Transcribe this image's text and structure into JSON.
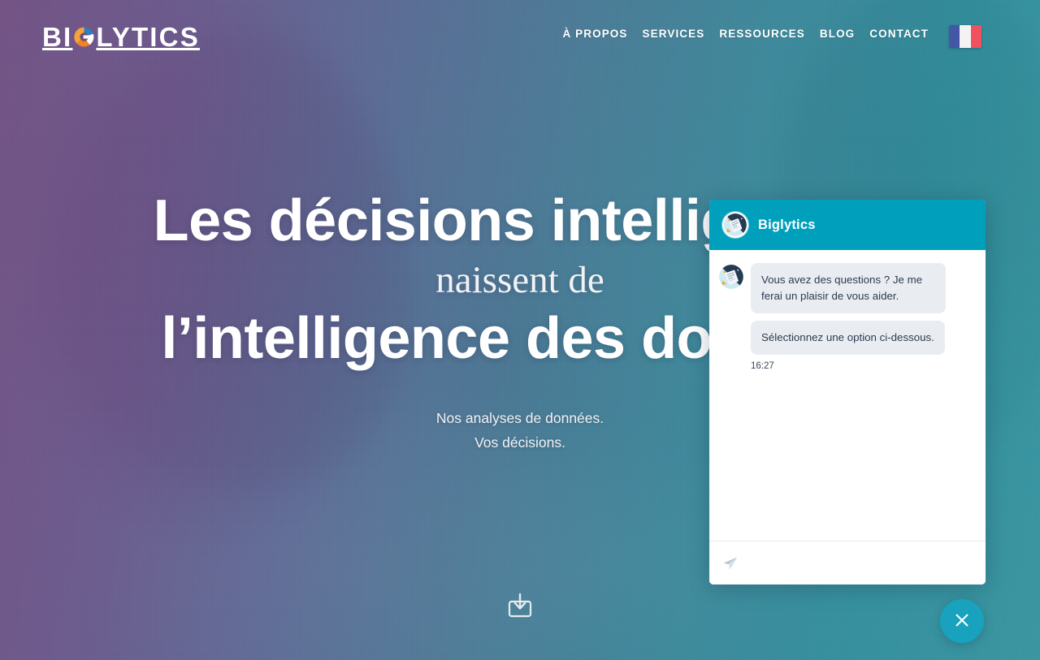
{
  "brand": {
    "logo_text_before": "BI",
    "logo_text_g": "G",
    "logo_text_after": "LYTICS",
    "accent_teal": "#00a0bd",
    "accent_orange": "#f58220",
    "accent_blue": "#2f7fc1"
  },
  "nav": {
    "items": [
      {
        "label": "À PROPOS",
        "name": "nav-a-propos"
      },
      {
        "label": "SERVICES",
        "name": "nav-services"
      },
      {
        "label": "RESSOURCES",
        "name": "nav-ressources"
      },
      {
        "label": "BLOG",
        "name": "nav-blog"
      },
      {
        "label": "CONTACT",
        "name": "nav-contact"
      }
    ],
    "language_flag": "france-flag"
  },
  "hero": {
    "line1": "Les décisions intelligentes",
    "line2": "naissent de",
    "line3": "l’intelligence des données",
    "sub_line1": "Nos analyses de données.",
    "sub_line2": "Vos décisions.",
    "scroll_icon": "download-arrow-icon"
  },
  "chat": {
    "title": "Biglytics",
    "avatar_icon": "biglytics-bot-avatar",
    "messages": [
      {
        "text": "Vous avez des questions ? Je me ferai un plaisir de vous aider.",
        "sender": "bot"
      },
      {
        "text": "Sélectionnez une option ci-dessous.",
        "sender": "bot"
      }
    ],
    "timestamp": "16:27",
    "input_placeholder": "",
    "input_value": "",
    "send_icon": "paper-plane-icon",
    "header_color": "#00a0bd",
    "bubble_color": "#e9edf2"
  },
  "fab": {
    "icon": "close-icon",
    "color": "#18a2bd"
  }
}
